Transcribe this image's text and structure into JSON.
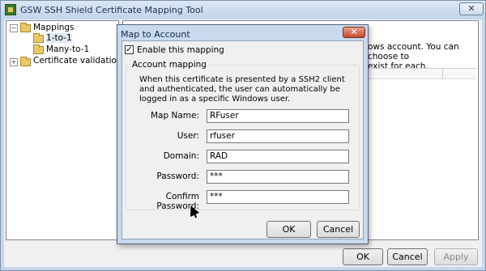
{
  "window": {
    "title": "GSW SSH Shield Certificate Mapping Tool",
    "close_label": "✕"
  },
  "tree": {
    "items": [
      {
        "label": "Mappings",
        "expander": "−"
      },
      {
        "label": "1-to-1"
      },
      {
        "label": "Many-to-1"
      },
      {
        "label": "Certificate validation",
        "expander": "+"
      }
    ]
  },
  "panel": {
    "partial_text": "ows account. You can choose to\nexist for each."
  },
  "footer": {
    "ok": "OK",
    "cancel": "Cancel",
    "apply": "Apply"
  },
  "dialog": {
    "title": "Map to Account",
    "close_label": "✕",
    "enable_label": "Enable this mapping",
    "enable_checked": "✓",
    "group_label": "Account mapping",
    "info": "When this certificate is presented by a SSH2 client and authenticated, the user can automatically be logged in as a specific Windows user.",
    "fields": {
      "map_name": {
        "label": "Map Name:",
        "value": "RFuser"
      },
      "user": {
        "label": "User:",
        "value": "rfuser"
      },
      "domain": {
        "label": "Domain:",
        "value": "RAD"
      },
      "password": {
        "label": "Password:",
        "value": "***"
      },
      "confirm_password": {
        "label": "Confirm Password:",
        "value": "***"
      }
    },
    "ok": "OK",
    "cancel": "Cancel"
  }
}
